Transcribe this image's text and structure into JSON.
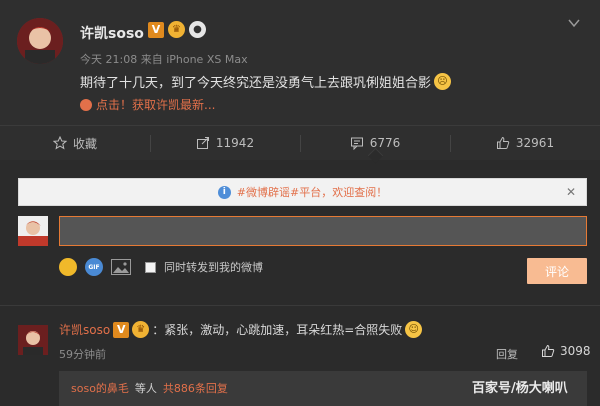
{
  "post": {
    "username": "许凯soso",
    "badge_v": "V",
    "meta": "今天 21:08 来自 iPhone XS Max",
    "text": "期待了十几天，到了今天终究还是没勇气上去跟巩俐姐姐合影",
    "link": "点击！获取许凯最新..."
  },
  "actions": [
    {
      "label": "收藏",
      "icon": "star-icon"
    },
    {
      "label": "11942",
      "icon": "share-icon"
    },
    {
      "label": "6776",
      "icon": "comment-icon"
    },
    {
      "label": "32961",
      "icon": "like-icon"
    }
  ],
  "notice": {
    "text": "#微博辟谣#平台，欢迎查阅！",
    "close": "✕"
  },
  "composer": {
    "input_value": "",
    "gif_label": "GIF",
    "forward_label": "同时转发到我的微博",
    "submit_label": "评论"
  },
  "comment": {
    "username": "许凯soso",
    "badge_v": "V",
    "text": "：紧张，激动，心跳加速，耳朵红热=合照失败",
    "time": "59分钟前",
    "reply_label": "回复",
    "likes": "3098"
  },
  "replies": {
    "user": "soso的鼻毛",
    "mid": "等人",
    "count": "共886条回复"
  },
  "watermark": "百家号/杨大喇叭",
  "colors": {
    "accent": "#e2704a",
    "background": "#2b2b2b",
    "input_border": "#e67a35",
    "submit_bg": "#f8bb92"
  }
}
